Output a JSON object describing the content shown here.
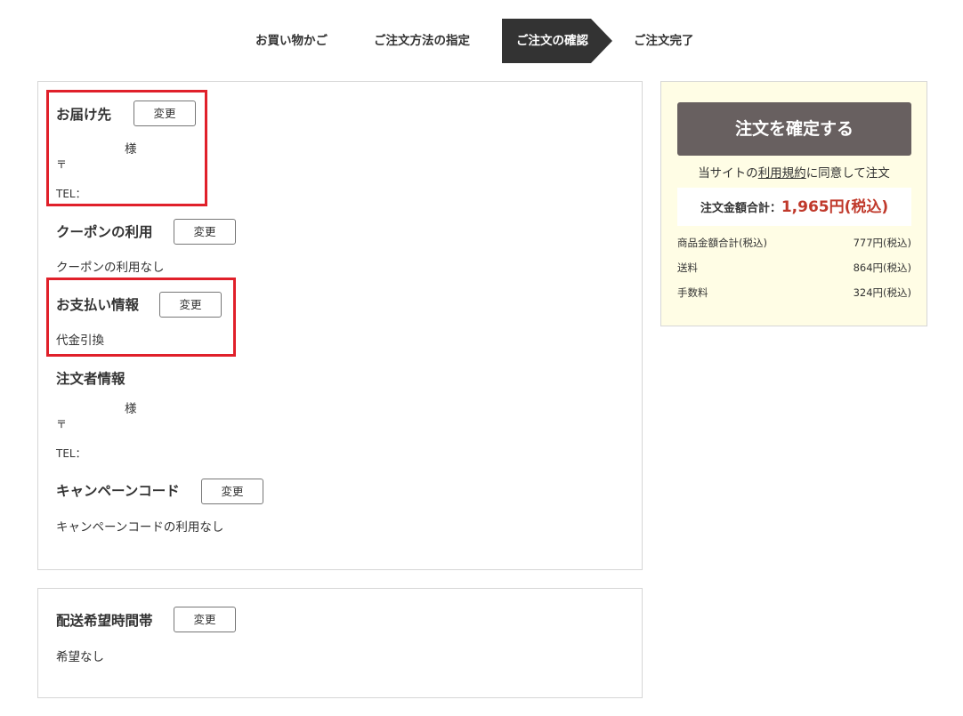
{
  "steps": [
    "お買い物かご",
    "ご注文方法の指定",
    "ご注文の確認",
    "ご注文完了"
  ],
  "change_label": "変更",
  "delivery": {
    "title": "お届け先",
    "name_suffix": "様",
    "postal": "〒",
    "tel_label": "TEL："
  },
  "coupon": {
    "title": "クーポンの利用",
    "value": "クーポンの利用なし"
  },
  "payment": {
    "title": "お支払い情報",
    "value": "代金引換"
  },
  "orderer": {
    "title": "注文者情報",
    "name_suffix": "様",
    "postal": "〒",
    "tel_label": "TEL："
  },
  "campaign": {
    "title": "キャンペーンコード",
    "value": "キャンペーンコードの利用なし"
  },
  "delivery_time": {
    "title": "配送希望時間帯",
    "value": "希望なし"
  },
  "sidebar": {
    "confirm_label": "注文を確定する",
    "agree_prefix": "当サイトの",
    "agree_link": "利用規約",
    "agree_suffix": "に同意して注文",
    "total_label": "注文金額合計：",
    "total_value": "1,965円(税込)",
    "lines": [
      {
        "label": "商品金額合計(税込)",
        "value": "777円(税込)"
      },
      {
        "label": "送料",
        "value": "864円(税込)"
      },
      {
        "label": "手数料",
        "value": "324円(税込)"
      }
    ]
  },
  "colors": {
    "highlight": "#e0202a",
    "active_step": "#333333",
    "confirm_button": "#686060",
    "total_value": "#c0392b",
    "sidebar_bg": "#fffde5"
  }
}
